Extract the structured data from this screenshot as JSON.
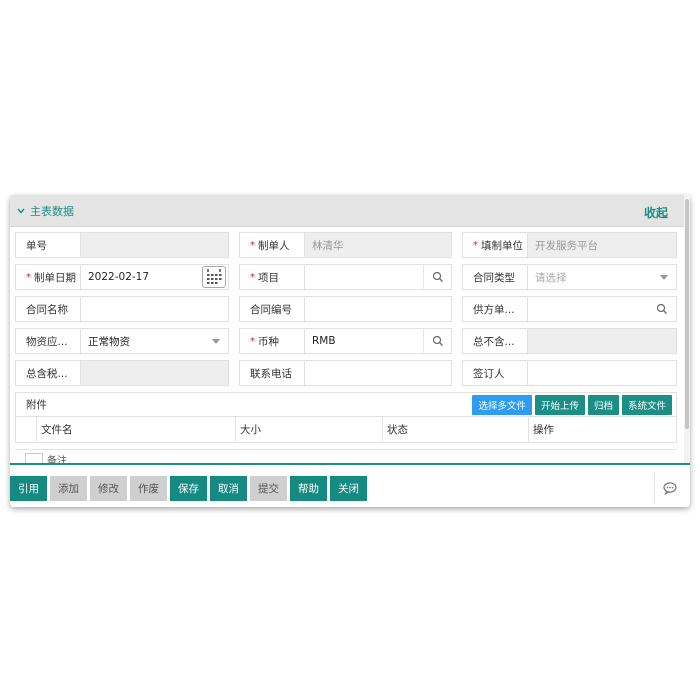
{
  "section": {
    "title": "主表数据",
    "collapse_label": "收起"
  },
  "form": {
    "row1": [
      {
        "label": "单号",
        "required": false,
        "value": ""
      },
      {
        "label": "制单人",
        "required": true,
        "value": "林清华"
      },
      {
        "label": "填制单位",
        "required": true,
        "value": "开发服务平台"
      }
    ],
    "row2": [
      {
        "label": "制单日期",
        "required": true,
        "value": "2022-02-17"
      },
      {
        "label": "项目",
        "required": true,
        "value": ""
      },
      {
        "label": "合同类型",
        "required": false,
        "placeholder": "请选择"
      }
    ],
    "row3": [
      {
        "label": "合同名称",
        "required": false,
        "value": ""
      },
      {
        "label": "合同编号",
        "required": false,
        "value": ""
      },
      {
        "label": "供方单...",
        "required": false,
        "value": ""
      }
    ],
    "row4": [
      {
        "label": "物资应...",
        "required": false,
        "value": "正常物资"
      },
      {
        "label": "币种",
        "required": true,
        "value": "RMB"
      },
      {
        "label": "总不含...",
        "required": false,
        "value": ""
      }
    ],
    "row5": [
      {
        "label": "总含税...",
        "required": false,
        "value": ""
      },
      {
        "label": "联系电话",
        "required": false,
        "value": ""
      },
      {
        "label": "签订人",
        "required": false,
        "value": ""
      }
    ]
  },
  "attachments": {
    "label": "附件",
    "buttons": [
      "选择多文件",
      "开始上传",
      "归档",
      "系统文件"
    ],
    "columns": [
      "文件名",
      "大小",
      "状态",
      "操作"
    ]
  },
  "remark": {
    "label": "备注"
  },
  "footer": {
    "buttons": [
      {
        "label": "引用",
        "enabled": true
      },
      {
        "label": "添加",
        "enabled": false
      },
      {
        "label": "修改",
        "enabled": false
      },
      {
        "label": "作废",
        "enabled": false
      },
      {
        "label": "保存",
        "enabled": true
      },
      {
        "label": "取消",
        "enabled": true
      },
      {
        "label": "提交",
        "enabled": false
      },
      {
        "label": "帮助",
        "enabled": true
      },
      {
        "label": "关闭",
        "enabled": true
      }
    ]
  },
  "colors": {
    "accent": "#1b8f86",
    "blue": "#2e9cf0",
    "required": "#e0201f",
    "disabled_bg": "#cfcfcf"
  }
}
